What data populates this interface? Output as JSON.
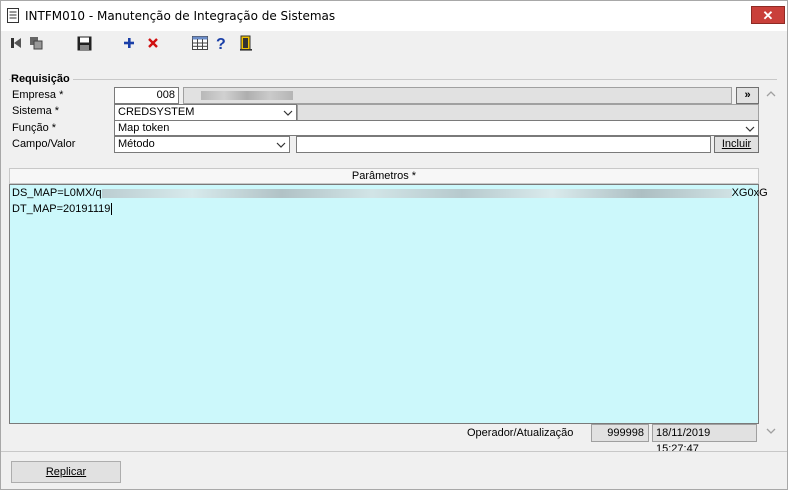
{
  "window": {
    "title": "INTFM010 - Manutenção de Integração de Sistemas",
    "close_label": "✕"
  },
  "toolbar": {
    "items": [
      {
        "name": "first-record-icon"
      },
      {
        "name": "copy-icon"
      },
      {
        "name": "save-icon"
      },
      {
        "name": "add-icon"
      },
      {
        "name": "delete-icon"
      },
      {
        "name": "grid-icon"
      },
      {
        "name": "help-icon"
      },
      {
        "name": "exit-icon"
      }
    ]
  },
  "requisicao": {
    "group_title": "Requisição",
    "empresa": {
      "label": "Empresa *",
      "code": "008",
      "nav_label": "»"
    },
    "sistema": {
      "label": "Sistema *",
      "value": "CREDSYSTEM"
    },
    "funcao": {
      "label": "Função *",
      "value": "Map token"
    },
    "campo_valor": {
      "label": "Campo/Valor",
      "campo": "Método",
      "valor": "",
      "incluir_label": "Incluir"
    }
  },
  "parametros": {
    "header": "Parâmetros *",
    "line1_prefix": "DS_MAP=L0MX/q",
    "line1_suffix": "XG0xG",
    "line2": "DT_MAP=20191119"
  },
  "footer": {
    "operador_label": "Operador/Atualização",
    "operador": "999998",
    "atualizacao": "18/11/2019 15:27:47"
  },
  "actions": {
    "replicar_label": "Replicar"
  },
  "colors": {
    "params_bg": "#ccf8fb",
    "close_bg": "#c9403a",
    "add_icon": "#1a3fa8",
    "delete_icon": "#d01010"
  }
}
